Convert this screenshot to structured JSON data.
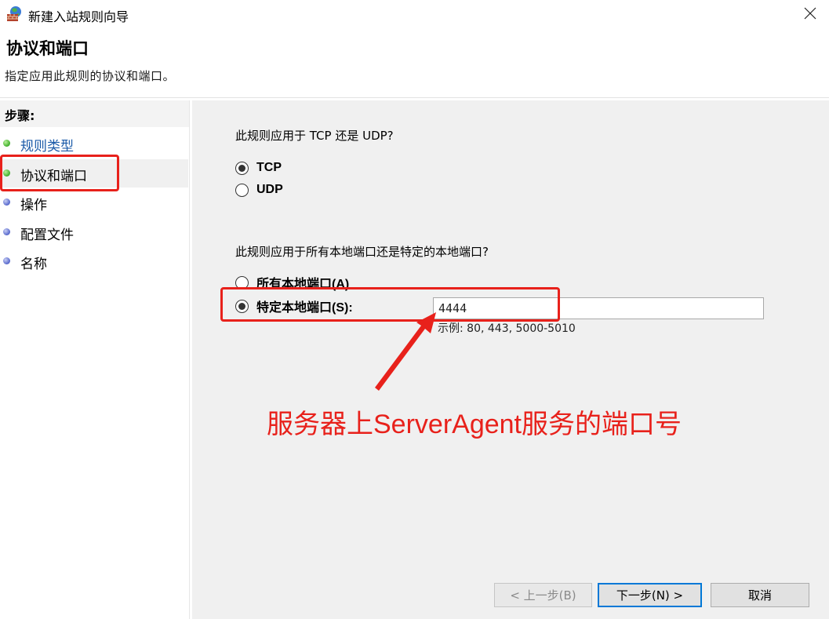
{
  "window": {
    "title": "新建入站规则向导",
    "close_icon": "close-icon",
    "app_icon": "firewall-icon"
  },
  "header": {
    "title": "协议和端口",
    "subtitle": "指定应用此规则的协议和端口。"
  },
  "steps": {
    "header": "步骤:",
    "items": [
      {
        "label": "规则类型",
        "status": "completed",
        "dot_color": "#3fae2a"
      },
      {
        "label": "协议和端口",
        "status": "current",
        "dot_color": "#3fae2a"
      },
      {
        "label": "操作",
        "status": "pending",
        "dot_color": "#5566cc"
      },
      {
        "label": "配置文件",
        "status": "pending",
        "dot_color": "#5566cc"
      },
      {
        "label": "名称",
        "status": "pending",
        "dot_color": "#5566cc"
      }
    ]
  },
  "protocol": {
    "question": "此规则应用于 TCP 还是 UDP?",
    "options": [
      {
        "label": "TCP",
        "checked": true
      },
      {
        "label": "UDP",
        "checked": false
      }
    ]
  },
  "ports": {
    "question": "此规则应用于所有本地端口还是特定的本地端口?",
    "options": [
      {
        "label": "所有本地端口(A)",
        "checked": false
      },
      {
        "label": "特定本地端口(S):",
        "checked": true
      }
    ],
    "value": "4444",
    "example": "示例: 80, 443, 5000-5010"
  },
  "annotation": {
    "text": "服务器上ServerAgent服务的端口号",
    "color": "#e8211b"
  },
  "buttons": {
    "back": "< 上一步(B)",
    "next": "下一步(N) >",
    "cancel": "取消"
  }
}
